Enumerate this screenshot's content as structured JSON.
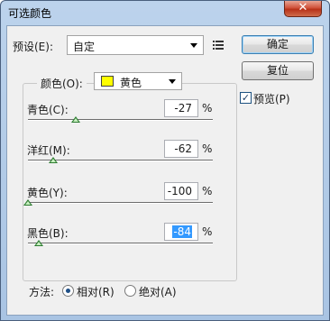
{
  "window": {
    "title": "可选颜色",
    "close_glyph": "✕"
  },
  "preset": {
    "label": "预设(E):",
    "value": "自定"
  },
  "buttons": {
    "ok": "确定",
    "reset": "复位"
  },
  "preview": {
    "label": "预览(P)",
    "checked": true,
    "check_glyph": "✓"
  },
  "colors": {
    "label": "颜色(O):",
    "value": "黄色",
    "swatch_color": "#ffff00"
  },
  "sliders": [
    {
      "label": "青色(C):",
      "value": "-27",
      "unit": "%",
      "level": -27
    },
    {
      "label": "洋红(M):",
      "value": "-62",
      "unit": "%",
      "level": -62
    },
    {
      "label": "黄色(Y):",
      "value": "-100",
      "unit": "%",
      "level": -100
    },
    {
      "label": "黑色(B):",
      "value": "-84",
      "unit": "%",
      "level": -84
    }
  ],
  "method": {
    "label": "方法:",
    "options": [
      {
        "label": "相对(R)",
        "selected": true
      },
      {
        "label": "绝对(A)",
        "selected": false
      }
    ]
  }
}
